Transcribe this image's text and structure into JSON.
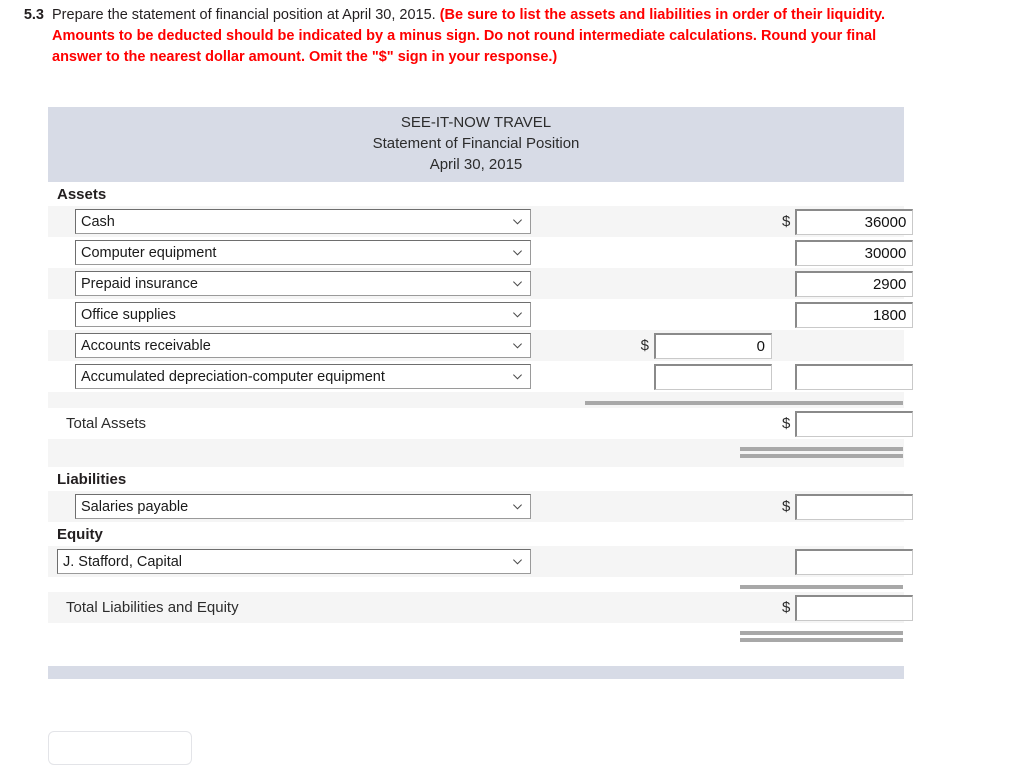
{
  "question": {
    "number": "5.3",
    "lead": "Prepare the statement of financial position at April 30, 2015. ",
    "emphasis": "(Be sure to list the assets and liabilities in order of their liquidity. Amounts to be deducted should be indicated by a minus sign. Do not round intermediate calculations. Round your final answer to the nearest dollar amount. Omit the \"$\" sign in your response.)"
  },
  "colors": {
    "header_band": "#d7dbe6",
    "emphasis_red": "#ff0000",
    "row_stripe": "#f5f5f5",
    "rule_gray": "#a8a8a8"
  },
  "statement": {
    "company": "SEE-IT-NOW TRAVEL",
    "title": "Statement of Financial Position",
    "date": "April 30, 2015",
    "sections": {
      "assets_heading": "Assets",
      "liabilities_heading": "Liabilities",
      "equity_heading": "Equity"
    },
    "asset_rows": [
      {
        "account": "Cash",
        "mid_dollar": false,
        "mid_value": "",
        "right_dollar": true,
        "right_value": "36000"
      },
      {
        "account": "Computer equipment",
        "mid_dollar": false,
        "mid_value": "",
        "right_dollar": false,
        "right_value": "30000"
      },
      {
        "account": "Prepaid insurance",
        "mid_dollar": false,
        "mid_value": "",
        "right_dollar": false,
        "right_value": "2900"
      },
      {
        "account": "Office supplies",
        "mid_dollar": false,
        "mid_value": "",
        "right_dollar": false,
        "right_value": "1800"
      },
      {
        "account": "Accounts receivable",
        "mid_dollar": true,
        "mid_value": "0",
        "right_dollar": false,
        "right_value": null
      },
      {
        "account": "Accumulated depreciation-computer equipment",
        "mid_dollar": false,
        "mid_value": "",
        "right_dollar": false,
        "right_value": ""
      }
    ],
    "total_assets": {
      "label": "Total Assets",
      "dollar": "$",
      "value": ""
    },
    "liability_rows": [
      {
        "account": "Salaries payable",
        "dollar": true,
        "value": ""
      }
    ],
    "equity_rows": [
      {
        "account": "J. Stafford, Capital",
        "dollar": false,
        "value": ""
      }
    ],
    "total_liabilities_equity": {
      "label": "Total Liabilities and Equity",
      "dollar": "$",
      "value": ""
    },
    "dollar_sign": "$"
  }
}
